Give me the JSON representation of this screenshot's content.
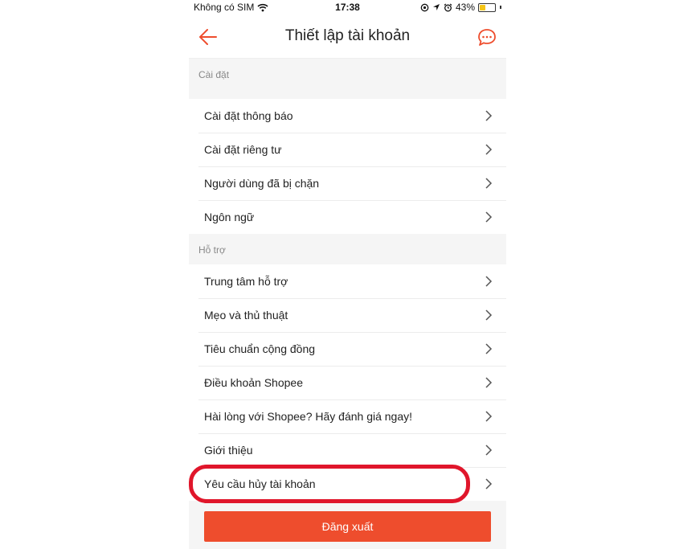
{
  "status_bar": {
    "carrier": "Không có SIM",
    "time": "17:38",
    "battery": "43%",
    "battery_level": 0.43
  },
  "nav": {
    "title": "Thiết lập tài khoản",
    "back_icon": "back-arrow-icon",
    "chat_icon": "chat-bubbles-icon",
    "accent_color": "#ee4d2d"
  },
  "sections": {
    "settings": {
      "header": "Cài đặt",
      "items": [
        {
          "label": "Cài đặt thông báo"
        },
        {
          "label": "Cài đặt riêng tư"
        },
        {
          "label": "Người dùng đã bị chặn"
        },
        {
          "label": "Ngôn ngữ"
        }
      ]
    },
    "support": {
      "header": "Hỗ trợ",
      "items": [
        {
          "label": "Trung tâm hỗ trợ"
        },
        {
          "label": "Mẹo và thủ thuật"
        },
        {
          "label": "Tiêu chuẩn cộng đồng"
        },
        {
          "label": "Điều khoản Shopee"
        },
        {
          "label": "Hài lòng với Shopee? Hãy đánh giá ngay!"
        },
        {
          "label": "Giới thiệu"
        },
        {
          "label": "Yêu cầu hủy tài khoản"
        }
      ]
    }
  },
  "logout": {
    "label": "Đăng xuất",
    "color": "#ee4d2d"
  },
  "highlight_color": "#e0162b"
}
